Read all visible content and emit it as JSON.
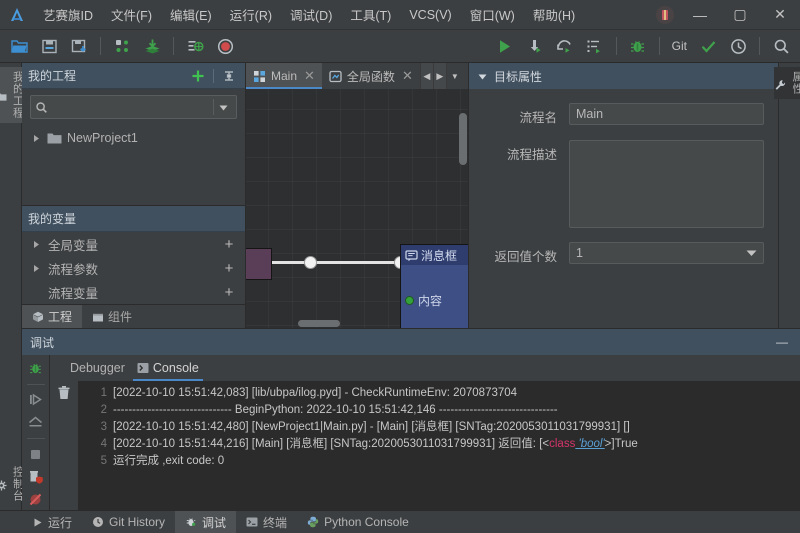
{
  "window": {
    "app_icon": "app-logo-icon",
    "menu": [
      "艺赛旗ID",
      "文件(F)",
      "编辑(E)",
      "运行(R)",
      "调试(D)",
      "工具(T)",
      "VCS(V)",
      "窗口(W)",
      "帮助(H)"
    ],
    "gift_icon": "gift-icon",
    "minimize": "—",
    "maximize": "▢",
    "close": "✕"
  },
  "toolbar": {
    "left": [
      {
        "name": "open-folder-icon",
        "tooltip": "打开"
      },
      {
        "name": "save-icon",
        "tooltip": "保存"
      },
      {
        "name": "save-as-icon",
        "tooltip": "另存为"
      },
      {
        "name": "components-icon",
        "tooltip": "组件"
      },
      {
        "name": "import-icon",
        "tooltip": "导入"
      },
      {
        "name": "settings-list-icon",
        "tooltip": "设置"
      },
      {
        "name": "record-icon",
        "tooltip": "录制"
      }
    ],
    "right": [
      {
        "name": "run-icon",
        "tooltip": "运行"
      },
      {
        "name": "step-into-icon",
        "tooltip": "单步进入"
      },
      {
        "name": "step-over-icon",
        "tooltip": "单步跳过"
      },
      {
        "name": "run-config-icon",
        "tooltip": "运行配置"
      },
      {
        "name": "debug-bug-icon",
        "tooltip": "调试"
      },
      {
        "name": "git-label",
        "label": "Git"
      },
      {
        "name": "check-icon",
        "tooltip": "提交"
      },
      {
        "name": "history-clock-icon",
        "tooltip": "历史"
      },
      {
        "name": "search-icon",
        "tooltip": "搜索"
      }
    ]
  },
  "left_rail": {
    "top": {
      "label": "我的工程",
      "icon": "folder-icon"
    },
    "bottom": {
      "label": "控制台",
      "icon": "gear-icon"
    }
  },
  "project_panel": {
    "title": "我的工程",
    "add_icon": "plus-icon",
    "collapse_icon": "collapse-all-icon",
    "search": {
      "placeholder": "",
      "value": "",
      "icon": "search-icon",
      "filter_icon": "filter-caret-icon"
    },
    "tree": [
      {
        "label": "NewProject1",
        "icon": "folder-icon",
        "expanded": false
      }
    ]
  },
  "variables_panel": {
    "title": "我的变量",
    "rows": [
      {
        "label": "全局变量",
        "has_twisty": true,
        "add": "+"
      },
      {
        "label": "流程参数",
        "has_twisty": true,
        "add": "+"
      },
      {
        "label": "流程变量",
        "has_twisty": false,
        "add": "+"
      }
    ]
  },
  "project_tabs": [
    {
      "label": "工程",
      "icon": "cube-icon",
      "active": true
    },
    {
      "label": "组件",
      "icon": "package-icon",
      "active": false
    }
  ],
  "editor": {
    "tabs": [
      {
        "label": "Main",
        "icon": "flow-icon",
        "active": true,
        "close": "✕"
      },
      {
        "label": "全局函数",
        "icon": "function-icon",
        "active": false,
        "close": "✕"
      }
    ],
    "nav": {
      "prev": "◀",
      "next": "▶",
      "list": "▼"
    },
    "canvas": {
      "nodes": [
        {
          "name": "start-node",
          "label": "",
          "type": "purple"
        },
        {
          "name": "message-box-node",
          "label": "消息框",
          "port_label": "内容",
          "type": "message"
        }
      ]
    }
  },
  "properties_panel": {
    "title": "目标属性",
    "collapse_icon": "triangle-down-icon",
    "fields": [
      {
        "label": "流程名",
        "type": "text",
        "value": "Main"
      },
      {
        "label": "流程描述",
        "type": "textarea",
        "value": ""
      },
      {
        "label": "返回值个数",
        "type": "select",
        "value": "1"
      }
    ]
  },
  "right_rail": {
    "label": "属性",
    "icon": "wrench-icon"
  },
  "debug_panel": {
    "title": "调试",
    "minimize": "—",
    "tabs": [
      {
        "label": "Debugger",
        "active": false
      },
      {
        "label": "Console",
        "icon": "console-icon",
        "active": true
      }
    ],
    "rail_icons": [
      "debug-bug-icon",
      "resume-icon",
      "step-out-icon",
      "stop-icon",
      "remove-breakpoints-icon",
      "mute-breakpoints-icon"
    ],
    "console_tool_icons": [
      "trash-icon"
    ],
    "console_lines": [
      {
        "n": "1",
        "text": "[2022-10-10 15:51:42,083] [lib/ubpa/ilog.pyd] - CheckRuntimeEnv: 2070873704"
      },
      {
        "n": "2",
        "text": "------------------------------- BeginPython: 2022-10-10 15:51:42,146 -------------------------------"
      },
      {
        "n": "3",
        "text": "[2022-10-10 15:51:42,480] [NewProject1|Main.py] - [Main] [消息框] [SNTag:2020053011031799931] []"
      },
      {
        "n": "4",
        "prefix": "[2022-10-10 15:51:44,216] [Main] [消息框] [SNTag:2020053011031799931]  返回值: [<",
        "token_class": "class",
        "token_bool": " 'bool'",
        "suffix": ">]True"
      },
      {
        "n": "5",
        "text": "运行完成 ,exit code: 0"
      }
    ]
  },
  "statusbar": [
    {
      "label": "运行",
      "icon": "play-icon",
      "active": false
    },
    {
      "label": "Git History",
      "icon": "clock-icon",
      "active": false
    },
    {
      "label": "调试",
      "icon": "bug-icon",
      "active": true
    },
    {
      "label": "终端",
      "icon": "terminal-icon",
      "active": false
    },
    {
      "label": "Python Console",
      "icon": "python-icon",
      "active": false
    }
  ],
  "colors": {
    "accent_blue": "#4a88c7",
    "panel_header": "#41505e",
    "green": "#3c9e4a",
    "red": "#c0392b",
    "node_purple": "#5a3e58",
    "node_blue": "#3e4f86"
  }
}
